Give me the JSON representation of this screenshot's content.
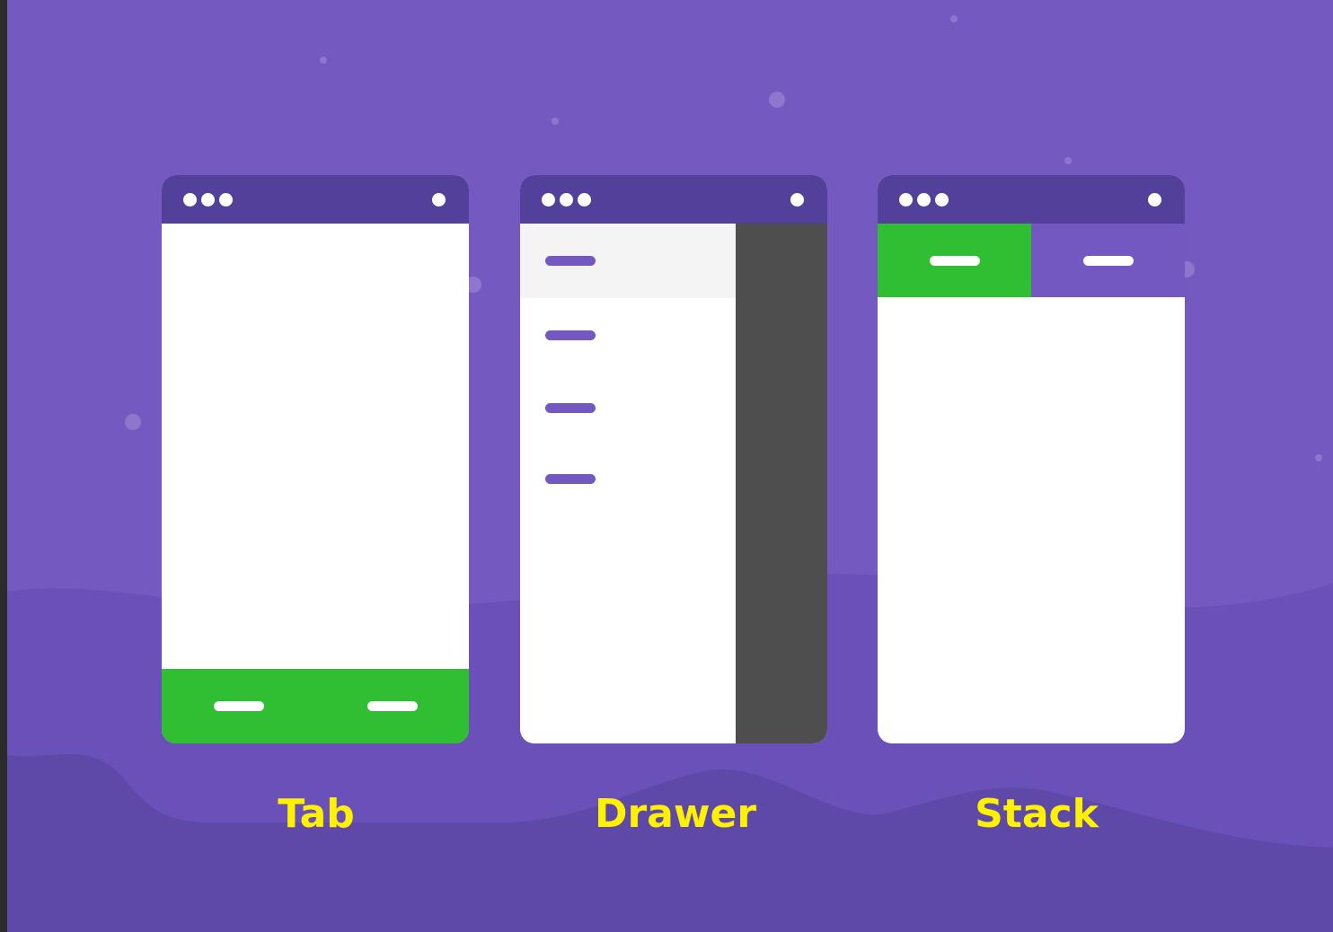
{
  "colors": {
    "background": "#7459c1",
    "background_dark": "#5e48a8",
    "background_mid": "#6a51b9",
    "status_bar": "#53409a",
    "tab_active": "#30be32",
    "tab_inactive": "#7358c1",
    "drawer_overlay": "#4e4e4e",
    "drawer_selected": "#f4f4f4",
    "caption": "#fff200",
    "left_edge": "#2b2b2b"
  },
  "icons": {
    "status_dots": "three-dots-icon",
    "status_indicator": "circle-icon",
    "tab_label_placeholder": "line-placeholder-icon"
  },
  "diagrams": [
    {
      "caption": "Tab"
    },
    {
      "caption": "Drawer"
    },
    {
      "caption": "Stack"
    }
  ]
}
